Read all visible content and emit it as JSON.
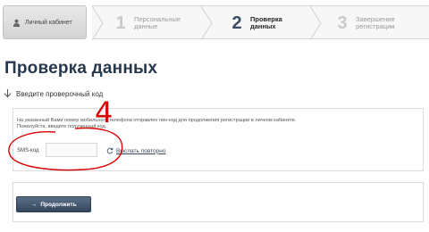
{
  "steps_bar": {
    "cabinet_label": "Личный кабинет",
    "steps": [
      {
        "number": "1",
        "label": "Персональные данные",
        "active": false
      },
      {
        "number": "2",
        "label": "Проверка данных",
        "active": true
      },
      {
        "number": "3",
        "label": "Завершение регистрации",
        "active": false
      }
    ]
  },
  "page": {
    "title": "Проверка данных",
    "subtitle": "Введите проверочный код"
  },
  "form": {
    "info_line1": "На указанный Вами номер мобильного телефона отправлен пин-код для продолжения регистрации в личном кабинете.",
    "info_line2": "Пожалуйста, введите полученный код.",
    "sms_label": "SMS-код",
    "sms_value": "",
    "resend_label": "Выслать повторно"
  },
  "annotation": {
    "number": "4",
    "color": "#d80000"
  },
  "actions": {
    "continue_label": "Продолжить"
  },
  "colors": {
    "accent": "#3a4d63",
    "button": "#3f526a"
  }
}
